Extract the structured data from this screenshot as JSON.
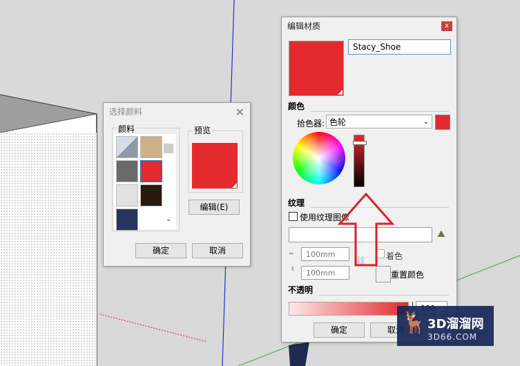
{
  "colors": {
    "material_red": "#e32a2c",
    "accent_blue": "#2f6fb8"
  },
  "color_picker_dialog": {
    "title": "选择颜料",
    "group_label": "颜料",
    "preview_label": "预览",
    "edit_button": "编辑(E)",
    "ok_button": "确定",
    "cancel_button": "取消"
  },
  "edit_material_dialog": {
    "title": "编辑材质",
    "name_value": "Stacy_Shoe",
    "color_section": "颜色",
    "picker_label": "拾色器:",
    "picker_value": "色轮",
    "texture_section": "纹理",
    "use_texture_label": "使用纹理图像",
    "width_value": "100mm",
    "height_value": "100mm",
    "tint_label": "着色",
    "reset_color_label": "重置颜色",
    "opacity_section": "不透明",
    "opacity_value": "100",
    "ok_button": "确定",
    "cancel_button": "取消"
  },
  "watermark": {
    "line1": "3D溜溜网",
    "line2": "3D66.COM"
  }
}
